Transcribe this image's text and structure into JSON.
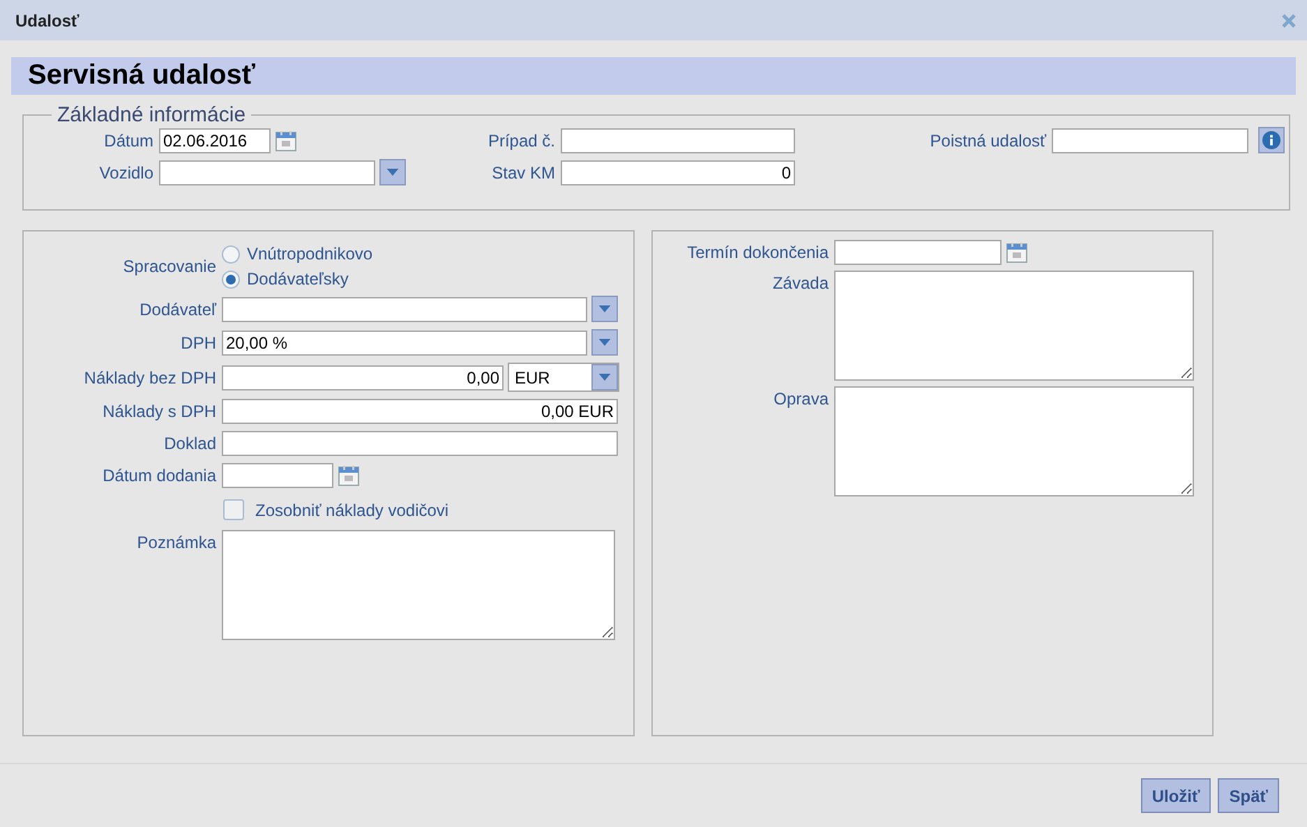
{
  "window": {
    "title": "Udalosť"
  },
  "page_title": "Servisná udalosť",
  "basic_info": {
    "legend": "Základné informácie",
    "datum": {
      "label": "Dátum",
      "value": "02.06.2016"
    },
    "pripad": {
      "label": "Prípad č."
    },
    "poistna": {
      "label": "Poistná udalosť"
    },
    "vozidlo": {
      "label": "Vozidlo"
    },
    "stav_km": {
      "label": "Stav KM",
      "value": "0"
    }
  },
  "left_panel": {
    "spracovanie": {
      "label": "Spracovanie",
      "options": [
        {
          "label": "Vnútropodnikovo",
          "selected": false
        },
        {
          "label": "Dodávateľsky",
          "selected": true
        }
      ]
    },
    "dodavatel": {
      "label": "Dodávateľ"
    },
    "dph": {
      "label": "DPH",
      "value": "20,00 %"
    },
    "naklady_bez": {
      "label": "Náklady bez DPH",
      "value": "0,00",
      "currency": "EUR"
    },
    "naklady_s": {
      "label": "Náklady s DPH",
      "value": "0,00 EUR"
    },
    "doklad": {
      "label": "Doklad"
    },
    "datum_dodania": {
      "label": "Dátum dodania"
    },
    "zosobnit": {
      "label": "Zosobniť náklady vodičovi",
      "checked": false
    },
    "poznamka": {
      "label": "Poznámka"
    }
  },
  "right_panel": {
    "termin": {
      "label": "Termín dokončenia"
    },
    "zavada": {
      "label": "Závada"
    },
    "oprava": {
      "label": "Oprava"
    }
  },
  "buttons": [
    "Uložiť",
    "Späť"
  ]
}
